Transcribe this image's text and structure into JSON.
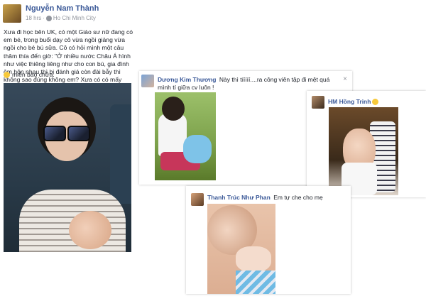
{
  "post": {
    "author": "Nguyễn Nam Thành",
    "time": "18 hrs",
    "separator": "·",
    "location": "Ho Chi Minh City",
    "text": "Xưa đi học bên UK, có một Giáo sư nữ đang có em bé, trong buổi dạy cô vừa ngồi giảng vừa ngồi cho bé bú sữa. Cô có hỏi mình một câu thâm thía đến giờ: \"Ở nhiều nước Châu Á hình như việc thiêng liêng như cho con bú, gia đình ôm hôn nhau thì bị đánh giá còn đài bẫy thì không sao đúng không em? Xưa có có mấy người bạn qua Việt Nam về kể lại vậy\"",
    "footer": "miễn bào chữa."
  },
  "comments": [
    {
      "name": "Dương Kim Thương",
      "text": "Này thì tííííí....ra công viên tập đi mệt quá mình tí giữa cv luôn !",
      "close": "×"
    },
    {
      "name": "HM Hồng Trinh",
      "text": ""
    },
    {
      "name": "Thanh Trúc Như Phan",
      "text": "Em tự che cho mẹ"
    }
  ],
  "colors": {
    "name_link": "#3b5998",
    "meta_text": "#90949c",
    "body_text": "#1d2129"
  },
  "icons": {
    "location": "globe-icon",
    "emoji_smile": "smile-emoji-icon",
    "emoji_inline": "smile-emoji-icon",
    "close": "close-icon"
  }
}
